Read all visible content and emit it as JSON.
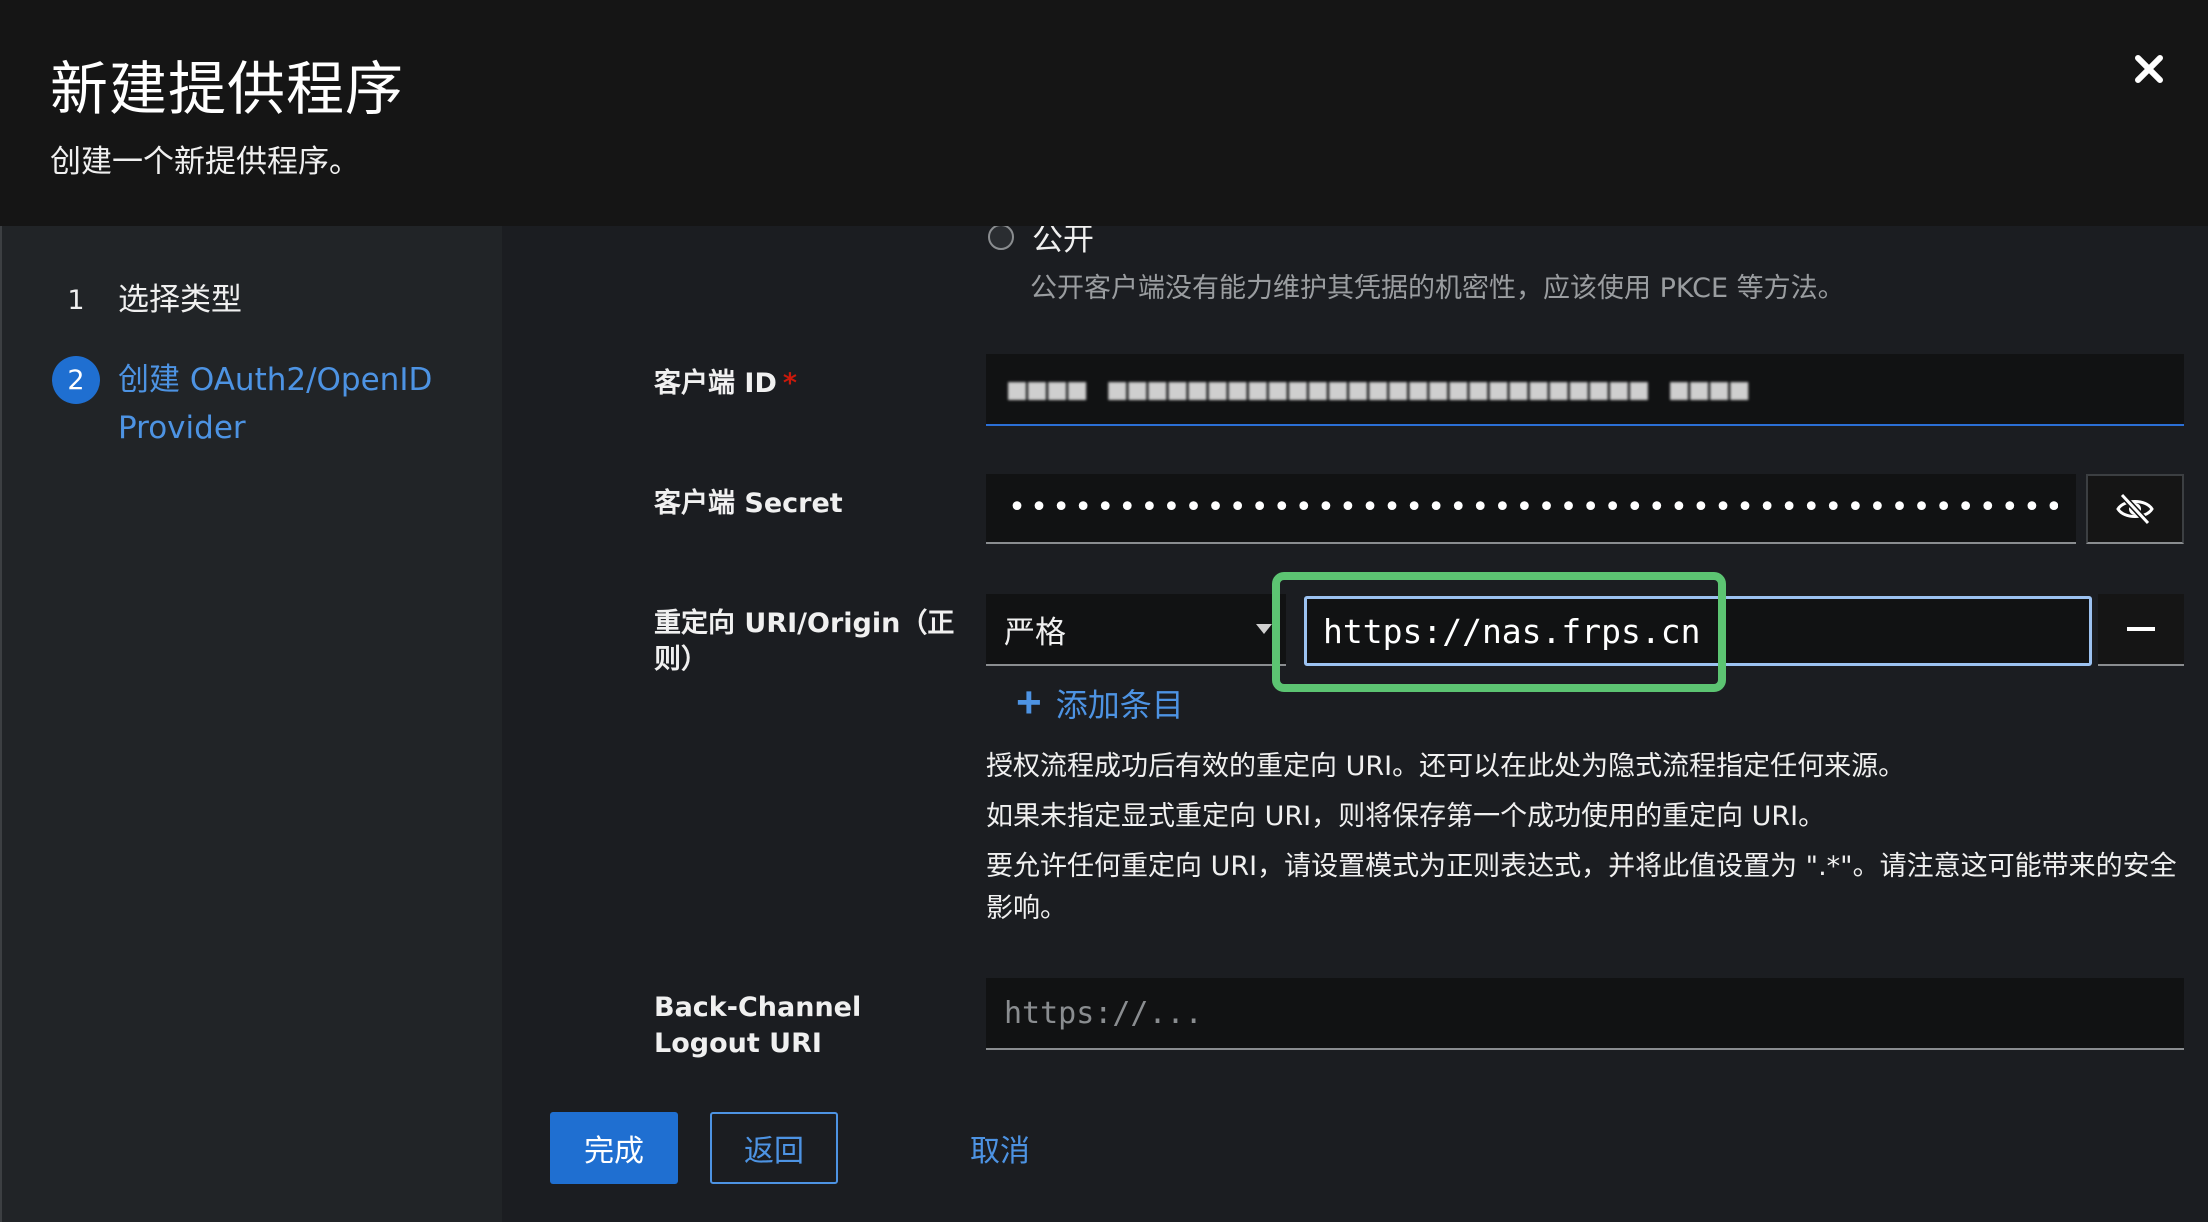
{
  "header": {
    "title": "新建提供程序",
    "subtitle": "创建一个新提供程序。",
    "close_icon": "close-icon"
  },
  "nav": {
    "steps": [
      {
        "number": "1",
        "label": "选择类型"
      },
      {
        "number": "2",
        "label": "创建 OAuth2/OpenID Provider"
      }
    ]
  },
  "form": {
    "client_type": {
      "option_label": "公开",
      "option_help": "公开客户端没有能力维护其凭据的机密性，应该使用 PKCE 等方法。"
    },
    "client_id": {
      "label": "客户端 ID",
      "required_mark": "*",
      "value": "■■■■ ■■■■■■■■■■■■■■■■■■■■■■■■■■■ ■■■■"
    },
    "client_secret": {
      "label": "客户端 Secret",
      "value": "•••••••••••••••••••••••••••••••••••••••••••••••••••••••••...",
      "toggle_icon": "eye-slash-icon"
    },
    "redirect_uri": {
      "label": "重定向 URI/Origin（正则）",
      "match_mode": "严格",
      "value": "https://nas.frps.cn",
      "add_entry_label": "添加条目",
      "help_lines": [
        "授权流程成功后有效的重定向 URI。还可以在此处为隐式流程指定任何来源。",
        "如果未指定显式重定向 URI，则将保存第一个成功使用的重定向 URI。",
        "要允许任何重定向 URI，请设置模式为正则表达式，并将此值设置为 \".*\"。请注意这可能带来的安全影响。"
      ]
    },
    "backchannel": {
      "label": "Back-Channel Logout URI",
      "placeholder": "https://..."
    }
  },
  "footer": {
    "finish_label": "完成",
    "back_label": "返回",
    "cancel_label": "取消"
  },
  "colors": {
    "accent": "#1f6fd1",
    "link": "#4d93e3",
    "highlight": "#5cc472"
  }
}
